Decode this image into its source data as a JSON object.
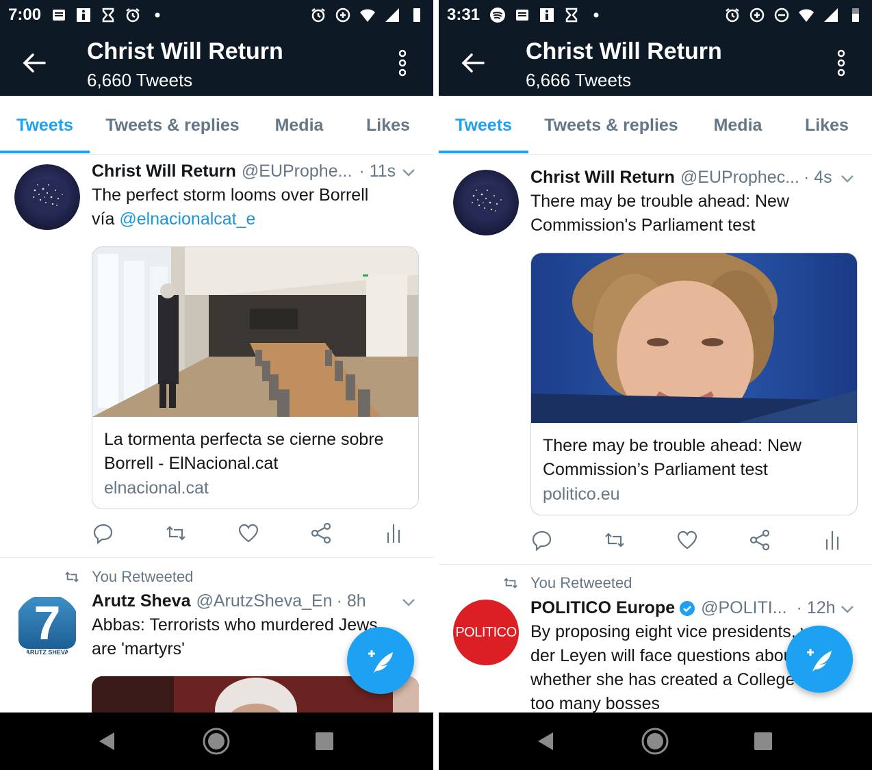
{
  "left": {
    "status": {
      "time": "7:00"
    },
    "appbar": {
      "title": "Christ Will Return",
      "count": "6,660 Tweets"
    },
    "tabs": [
      "Tweets",
      "Tweets & replies",
      "Media",
      "Likes"
    ],
    "tweet1": {
      "name": "Christ Will Return",
      "handle": "@EUProphe...",
      "time": "· 11s",
      "text": "The perfect storm looms over Borrell",
      "via": "vía",
      "mention": "@elnacionalcat_e",
      "card_title": "La tormenta perfecta se cierne sobre Borrell - ElNacional.cat",
      "card_domain": "elnacional.cat"
    },
    "retweet_label": "You Retweeted",
    "tweet2": {
      "name": "Arutz Sheva",
      "handle": "@ArutzSheva_En",
      "time": "· 8h",
      "text": "Abbas: Terrorists who murdered Jews are 'martyrs'",
      "avatar_glyph": "7",
      "avatar_caption": "ARUTZ SHEVA"
    }
  },
  "right": {
    "status": {
      "time": "3:31"
    },
    "appbar": {
      "title": "Christ Will Return",
      "count": "6,666 Tweets"
    },
    "tabs": [
      "Tweets",
      "Tweets & replies",
      "Media",
      "Likes"
    ],
    "tweet1": {
      "name": "Christ Will Return",
      "handle": "@EUProphec...",
      "time": "· 4s",
      "text": "There may be trouble ahead: New Commission's Parliament test",
      "card_title": "There may be trouble ahead: New Commission’s Parliament test",
      "card_domain": "politico.eu"
    },
    "retweet_label": "You Retweeted",
    "tweet2": {
      "name": "POLITICO Europe",
      "handle": "@POLITI...",
      "time": "· 12h",
      "text": "By proposing eight vice presidents, von der Leyen will face questions about whether she has created a College with too many bosses",
      "avatar_text": "POLITICO"
    }
  },
  "colors": {
    "accent": "#1da1f2",
    "appbar": "#0d1a26",
    "secondary_text": "#657786",
    "politico_red": "#dc1e25"
  }
}
